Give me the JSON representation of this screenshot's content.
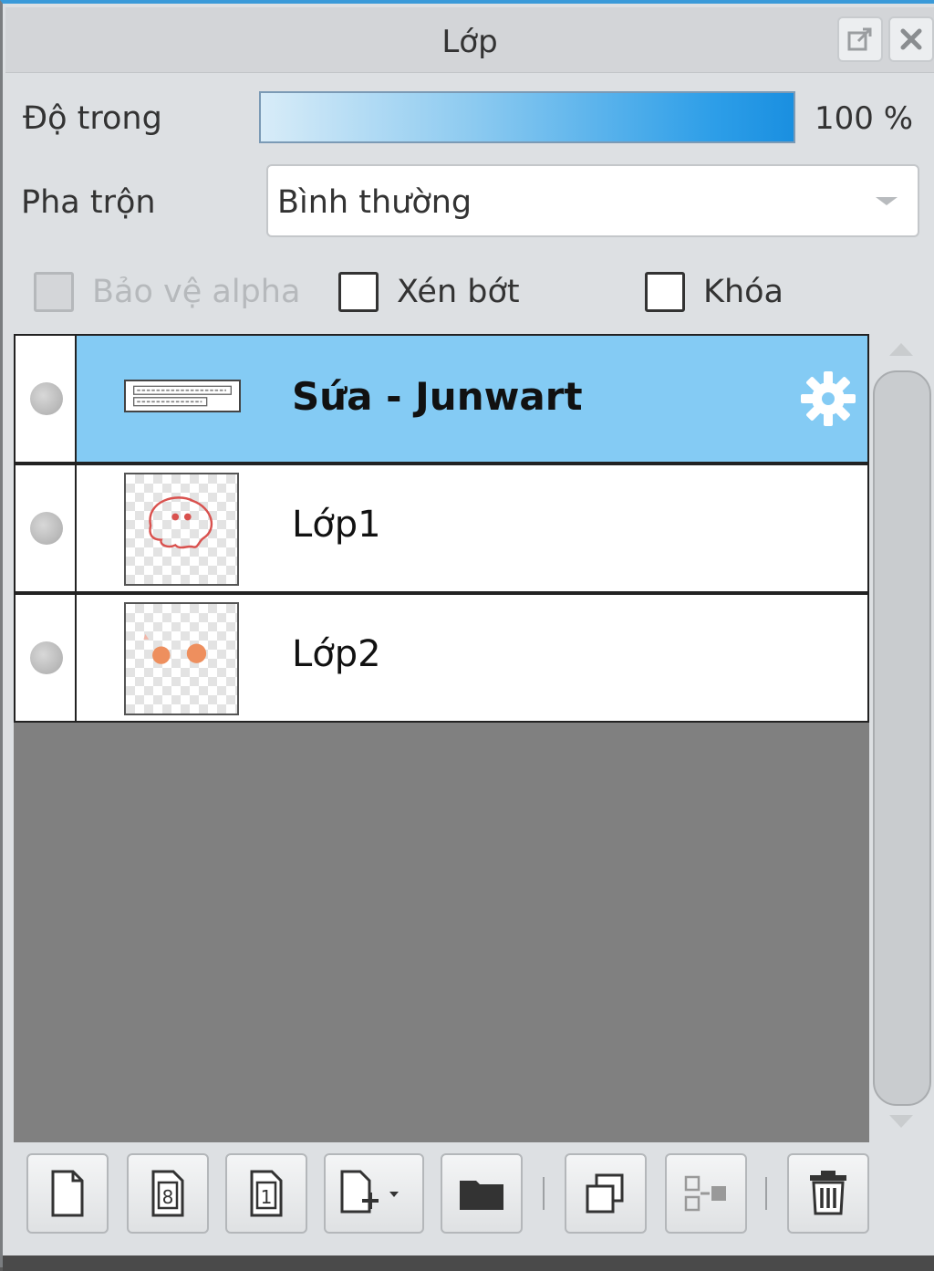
{
  "panel": {
    "title": "Lớp",
    "popout_icon": "popout-icon",
    "close_icon": "close-icon"
  },
  "opacity": {
    "label": "Độ trong",
    "value": "100 %",
    "level_percent": 100
  },
  "blend": {
    "label": "Pha trộn",
    "selected": "Bình thường"
  },
  "checkboxes": {
    "protect_alpha": {
      "label": "Bảo vệ alpha",
      "checked": false,
      "disabled": true
    },
    "clip": {
      "label": "Xén bớt",
      "checked": false
    },
    "lock": {
      "label": "Khóa",
      "checked": false
    }
  },
  "layers": [
    {
      "name": "Sứa - Junwart",
      "selected": true,
      "type": "text",
      "settings_icon": "gear-icon"
    },
    {
      "name": "Lớp1",
      "selected": false,
      "type": "raster"
    },
    {
      "name": "Lớp2",
      "selected": false,
      "type": "raster"
    }
  ],
  "toolbar": {
    "icons": [
      "new-layer-icon",
      "new-8bit-layer-icon",
      "new-1bit-layer-icon",
      "add-layer-menu-icon",
      "new-folder-icon",
      "duplicate-layer-icon",
      "merge-layer-icon",
      "delete-layer-icon"
    ]
  },
  "colors": {
    "accent": "#3a9ad9",
    "selected_row": "#84cbf4",
    "list_bg": "#808080"
  }
}
